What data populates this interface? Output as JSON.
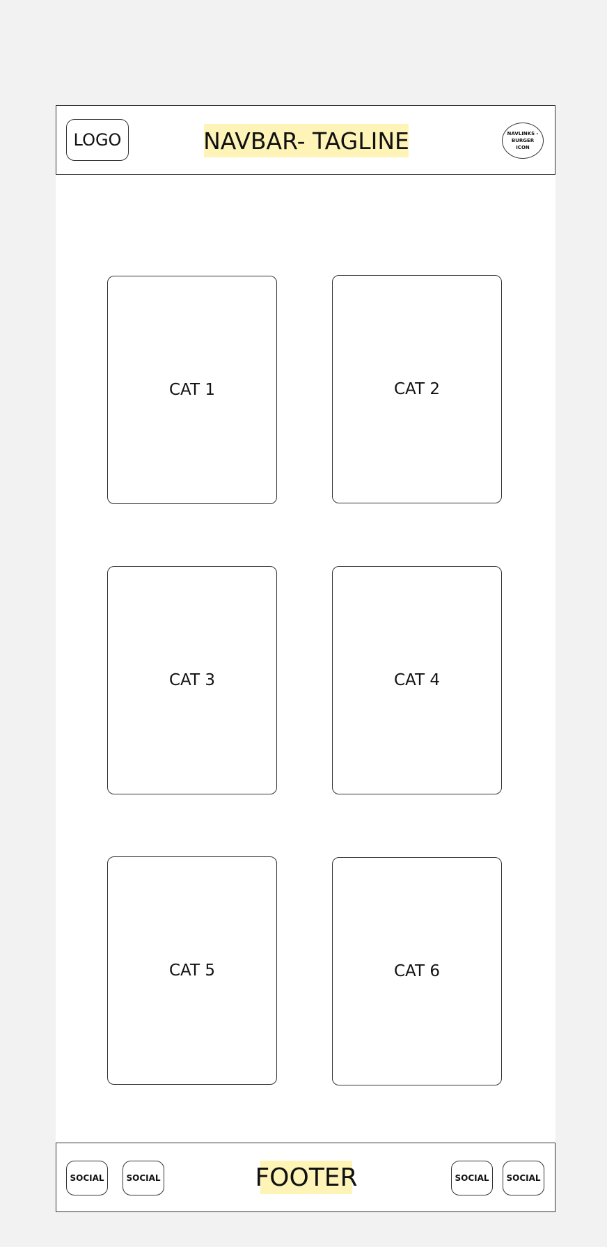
{
  "navbar": {
    "logo": "LOGO",
    "tagline": "NAVBAR- TAGLINE",
    "burger_lines": [
      "NAVLINKS -",
      "BURGER",
      "ICON"
    ]
  },
  "categories": [
    "CAT 1",
    "CAT 2",
    "CAT 3",
    "CAT 4",
    "CAT 5",
    "CAT 6"
  ],
  "footer": {
    "title": "FOOTER",
    "socials": [
      "SOCIAL",
      "SOCIAL",
      "SOCIAL",
      "SOCIAL"
    ]
  },
  "colors": {
    "highlight": "#fff4b8",
    "background": "#f2f2f2",
    "border": "#333333"
  }
}
